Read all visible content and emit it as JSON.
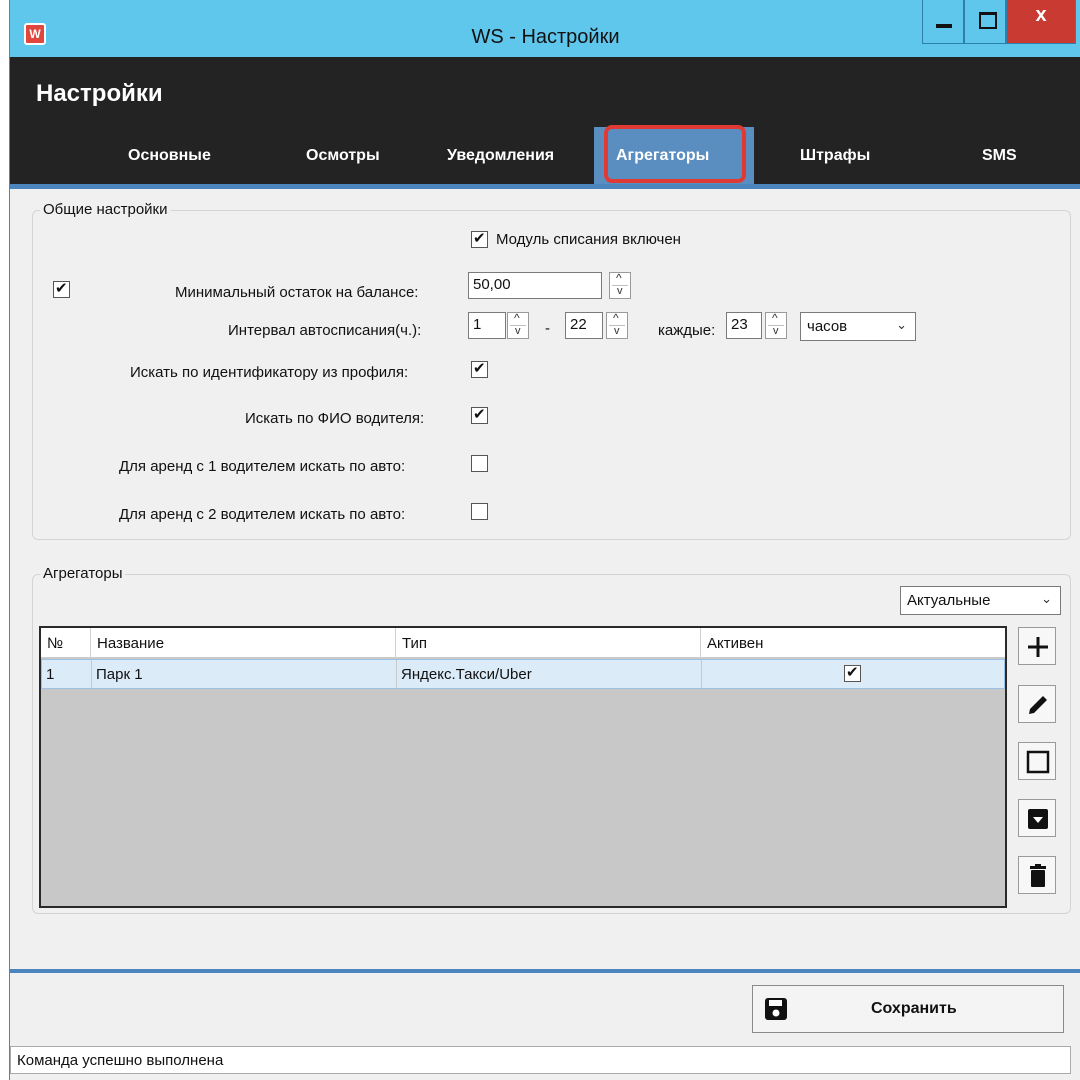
{
  "window": {
    "title": "WS - Настройки",
    "app_icon_letter": "W",
    "close_label": "x"
  },
  "header": {
    "title": "Настройки",
    "tabs": [
      {
        "label": "Основные"
      },
      {
        "label": "Осмотры"
      },
      {
        "label": "Уведомления"
      },
      {
        "label": "Агрегаторы",
        "active": true
      },
      {
        "label": "Штрафы"
      },
      {
        "label": "SMS"
      }
    ]
  },
  "general": {
    "group_label": "Общие настройки",
    "module_enabled_label": "Модуль списания включен",
    "module_enabled": true,
    "min_balance_enabled": true,
    "min_balance_label": "Минимальный остаток на балансе:",
    "min_balance_value": "50,00",
    "interval_label": "Интервал автосписания(ч.):",
    "interval_from": "1",
    "interval_dash": "-",
    "interval_to": "22",
    "every_label": "каждые:",
    "every_value": "23",
    "every_unit": "часов",
    "search_by_profile_id_label": "Искать по идентификатору из профиля:",
    "search_by_profile_id": true,
    "search_by_driver_name_label": "Искать по ФИО водителя:",
    "search_by_driver_name": true,
    "rent_1_driver_label": "Для аренд с 1 водителем искать по авто:",
    "rent_1_driver": false,
    "rent_2_driver_label": "Для аренд с 2 водителем искать по авто:",
    "rent_2_driver": false
  },
  "aggregators": {
    "group_label": "Агрегаторы",
    "filter_value": "Актуальные",
    "columns": [
      "№",
      "Название",
      "Тип",
      "Активен"
    ],
    "rows": [
      {
        "num": "1",
        "name": "Парк 1",
        "type": "Яндекс.Такси/Uber",
        "active": true
      }
    ],
    "side_buttons": [
      "plus-icon",
      "pencil-icon",
      "square-icon",
      "archive-icon",
      "trash-icon"
    ]
  },
  "footer": {
    "save_label": "Сохранить",
    "status_text": "Команда успешно выполнена"
  }
}
